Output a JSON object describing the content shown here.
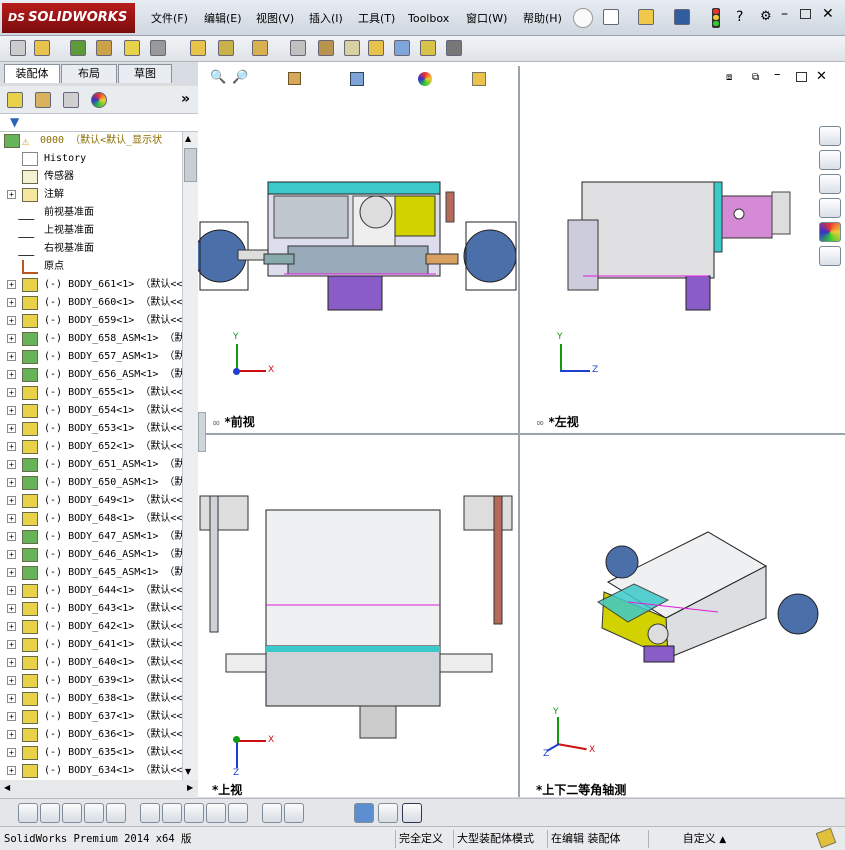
{
  "app": {
    "brand": "SOLIDWORKS",
    "brand_prefix": "DS"
  },
  "menu": [
    "文件(F)",
    "编辑(E)",
    "视图(V)",
    "插入(I)",
    "工具(T)",
    "Toolbox",
    "窗口(W)",
    "帮助(H)"
  ],
  "tabs": [
    "装配体",
    "布局",
    "草图"
  ],
  "tree": {
    "root": "0000 （默认<默认_显示状",
    "items": [
      {
        "label": "History",
        "kind": "history"
      },
      {
        "label": "传感器",
        "kind": "sensor"
      },
      {
        "label": "注解",
        "kind": "annot"
      },
      {
        "label": "前视基准面",
        "kind": "plane"
      },
      {
        "label": "上视基准面",
        "kind": "plane"
      },
      {
        "label": "右视基准面",
        "kind": "plane"
      },
      {
        "label": "原点",
        "kind": "origin"
      }
    ],
    "bodies": [
      {
        "label": "(-) BODY_661<1> （默认<<",
        "asm": false
      },
      {
        "label": "(-) BODY_660<1> （默认<<",
        "asm": false
      },
      {
        "label": "(-) BODY_659<1> （默认<<",
        "asm": false
      },
      {
        "label": "(-) BODY_658_ASM<1> （默",
        "asm": true
      },
      {
        "label": "(-) BODY_657_ASM<1> （默",
        "asm": true
      },
      {
        "label": "(-) BODY_656_ASM<1> （默",
        "asm": true
      },
      {
        "label": "(-) BODY_655<1> （默认<<",
        "asm": false
      },
      {
        "label": "(-) BODY_654<1> （默认<<",
        "asm": false
      },
      {
        "label": "(-) BODY_653<1> （默认<<",
        "asm": false
      },
      {
        "label": "(-) BODY_652<1> （默认<<",
        "asm": false
      },
      {
        "label": "(-) BODY_651_ASM<1> （默",
        "asm": true
      },
      {
        "label": "(-) BODY_650_ASM<1> （默",
        "asm": true
      },
      {
        "label": "(-) BODY_649<1> （默认<<",
        "asm": false
      },
      {
        "label": "(-) BODY_648<1> （默认<<",
        "asm": false
      },
      {
        "label": "(-) BODY_647_ASM<1> （默",
        "asm": true
      },
      {
        "label": "(-) BODY_646_ASM<1> （默",
        "asm": true
      },
      {
        "label": "(-) BODY_645_ASM<1> （默",
        "asm": true
      },
      {
        "label": "(-) BODY_644<1> （默认<<",
        "asm": false
      },
      {
        "label": "(-) BODY_643<1> （默认<<",
        "asm": false
      },
      {
        "label": "(-) BODY_642<1> （默认<<",
        "asm": false
      },
      {
        "label": "(-) BODY_641<1> （默认<<",
        "asm": false
      },
      {
        "label": "(-) BODY_640<1> （默认<<",
        "asm": false
      },
      {
        "label": "(-) BODY_639<1> （默认<<",
        "asm": false
      },
      {
        "label": "(-) BODY_638<1> （默认<<",
        "asm": false
      },
      {
        "label": "(-) BODY_637<1> （默认<<",
        "asm": false
      },
      {
        "label": "(-) BODY_636<1> （默认<<",
        "asm": false
      },
      {
        "label": "(-) BODY_635<1> （默认<<",
        "asm": false
      },
      {
        "label": "(-) BODY_634<1> （默认<<",
        "asm": false
      }
    ]
  },
  "viewports": {
    "front": "*前视",
    "left": "*左视",
    "top": "*上视",
    "iso": "*上下二等角轴测"
  },
  "axes": {
    "x": "X",
    "y": "Y",
    "z": "Z"
  },
  "status": {
    "product": "SolidWorks Premium 2014 x64 版",
    "def": "完全定义",
    "mode": "大型装配体模式",
    "editing": "在编辑 装配体",
    "units": "自定义"
  },
  "colors": {
    "brand": "#b81c1c",
    "accent_cyan": "#3cc9c9",
    "accent_yellow": "#d2d200",
    "accent_purple": "#8a5cc7",
    "accent_blue": "#4b6fa8",
    "sketch_magenta": "#e01bd8",
    "axis_x": "#d01010",
    "axis_y": "#0f9a0f",
    "axis_z": "#1f3fd0"
  }
}
